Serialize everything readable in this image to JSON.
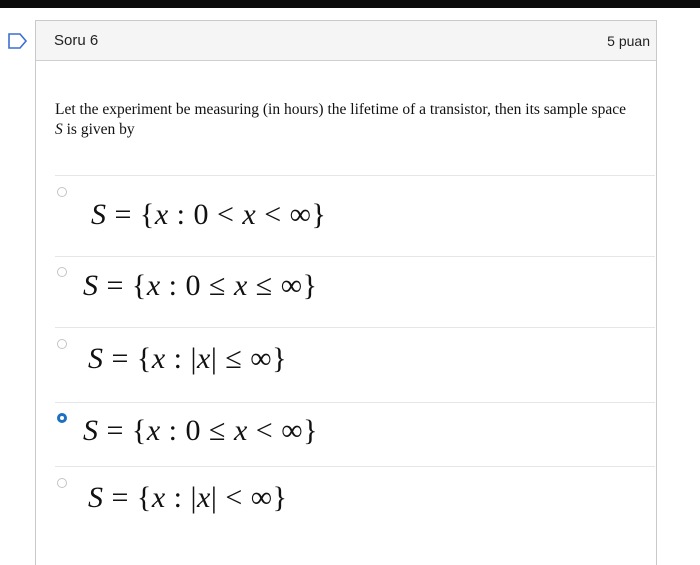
{
  "question": {
    "title": "Soru 6",
    "points": "5 puan",
    "prompt_line1": "Let the experiment be measuring (in hours) the lifetime of a transistor, then its sample space",
    "prompt_var": "S",
    "prompt_line2_rest": " is given by"
  },
  "options": [
    {
      "lhs": "S",
      "eq": " = {",
      "v1": "x",
      "mid": " : 0 < ",
      "v2": "x",
      "tail": " < ∞}",
      "selected": false
    },
    {
      "lhs": "S",
      "eq": " = {",
      "v1": "x",
      "mid": " : 0 ≤ ",
      "v2": "x",
      "tail": " ≤ ∞}",
      "selected": false
    },
    {
      "lhs": "S",
      "eq": " = {",
      "v1": "x",
      "mid": " :  |",
      "v2": "x",
      "tail": "| ≤ ∞}",
      "selected": false
    },
    {
      "lhs": "S",
      "eq": " = {",
      "v1": "x",
      "mid": " : 0 ≤ ",
      "v2": "x",
      "tail": " < ∞}",
      "selected": true
    },
    {
      "lhs": "S",
      "eq": " = {",
      "v1": "x",
      "mid": " :  |",
      "v2": "x",
      "tail": "| < ∞}",
      "selected": false
    }
  ],
  "colors": {
    "accent": "#1c6fc1",
    "flag": "#3b6fd1"
  },
  "icons": {
    "flag": "flag-outline-icon"
  }
}
